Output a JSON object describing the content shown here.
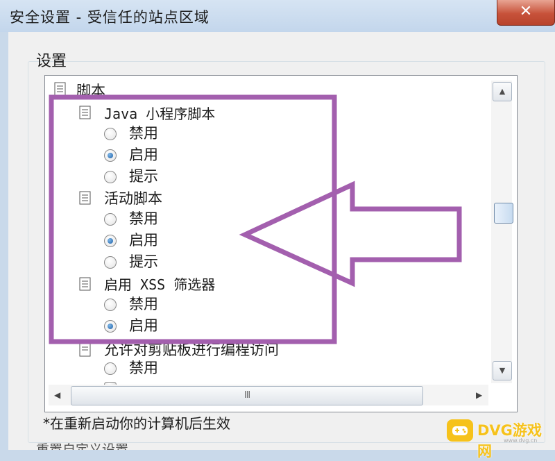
{
  "window": {
    "title": "安全设置 - 受信任的站点区域",
    "close_label": "✕"
  },
  "group": {
    "label": "设置"
  },
  "tree": {
    "root_label": "脚本",
    "section_java": "Java 小程序脚本",
    "section_active": "活动脚本",
    "section_xss": "启用 XSS 筛选器",
    "section_paste": "允许对剪贴板进行编程访问",
    "opt_disable": "禁用",
    "opt_enable": "启用",
    "opt_prompt": "提示",
    "selected": {
      "java": "启用",
      "active": "启用",
      "xss": "启用"
    }
  },
  "scrollbar": {
    "up": "▲",
    "down": "▼",
    "left": "◀",
    "right": "▶",
    "grip": "III"
  },
  "note": "*在重新启动你的计算机后生效",
  "bottom_label": "重置自定义设置",
  "watermark": {
    "brand": "DVG游戏网",
    "sub": "www.dvg.cn",
    "icon": "gamepad-icon"
  },
  "colors": {
    "highlight": "#a35fae",
    "titlebar": "#c9d9ea",
    "close": "#c7523a"
  }
}
